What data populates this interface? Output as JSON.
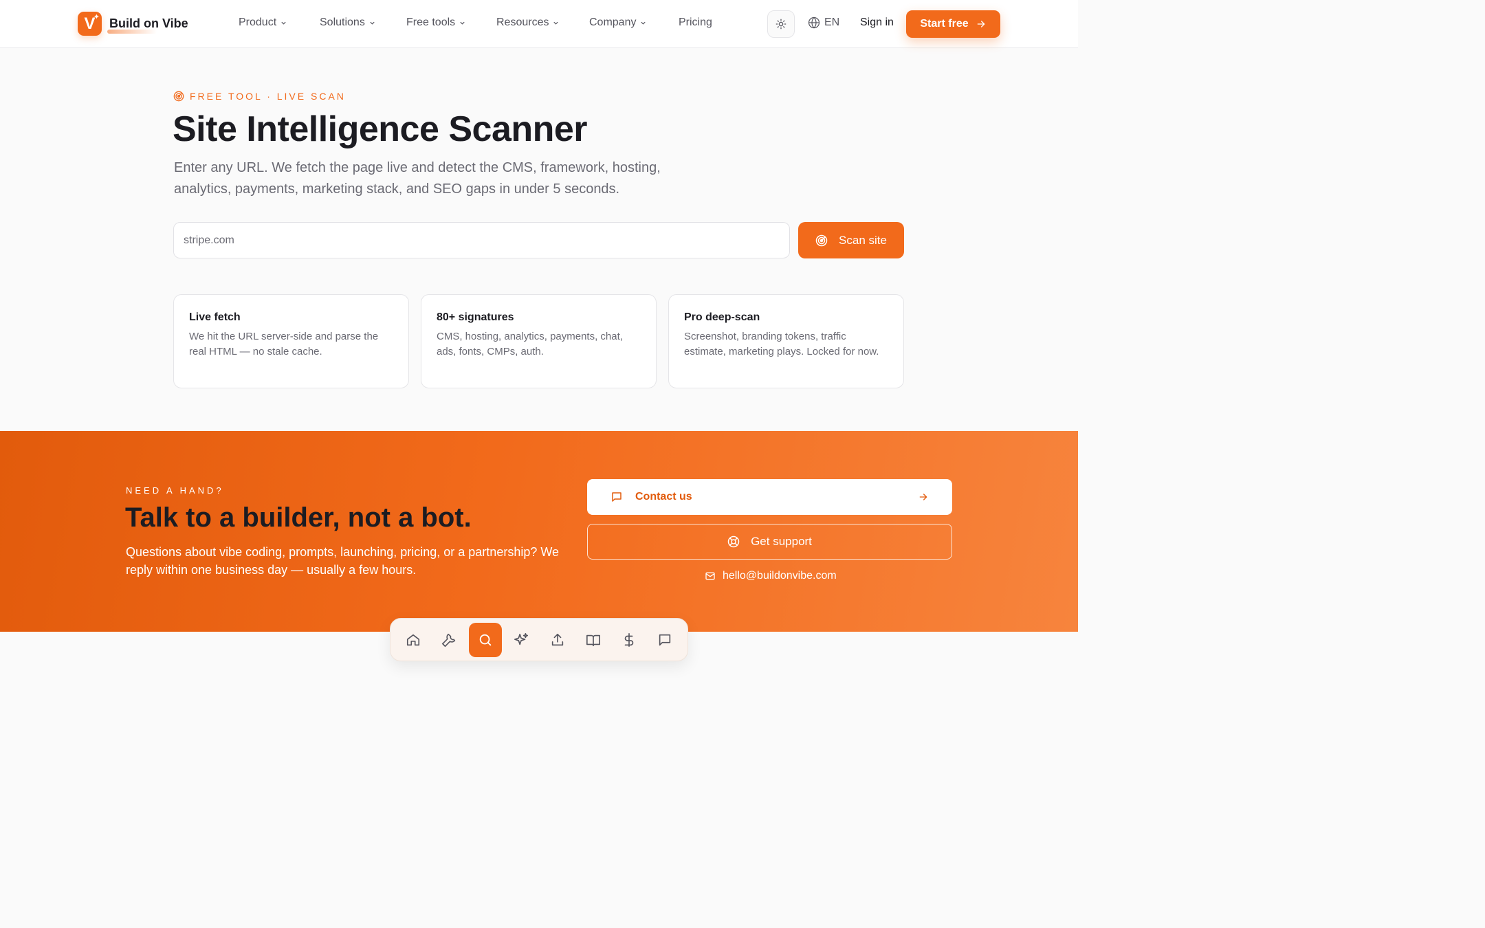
{
  "header": {
    "brand": "Build on Vibe",
    "logo_letter": "V",
    "nav": [
      {
        "label": "Product",
        "dropdown": true
      },
      {
        "label": "Solutions",
        "dropdown": true
      },
      {
        "label": "Free tools",
        "dropdown": true
      },
      {
        "label": "Resources",
        "dropdown": true
      },
      {
        "label": "Company",
        "dropdown": true
      },
      {
        "label": "Pricing",
        "dropdown": false
      }
    ],
    "theme_icon": "sun-icon",
    "language": "EN",
    "sign_in": "Sign in",
    "start_free": "Start free"
  },
  "hero": {
    "eyebrow": "FREE TOOL · LIVE SCAN",
    "title": "Site Intelligence Scanner",
    "subtitle": "Enter any URL. We fetch the page live and detect the CMS, framework, hosting, analytics, payments, marketing stack, and SEO gaps in under 5 seconds.",
    "input_placeholder": "stripe.com",
    "scan_button": "Scan site"
  },
  "features": [
    {
      "title": "Live fetch",
      "text": "We hit the URL server-side and parse the real HTML — no stale cache."
    },
    {
      "title": "80+ signatures",
      "text": "CMS, hosting, analytics, payments, chat, ads, fonts, CMPs, auth."
    },
    {
      "title": "Pro deep-scan",
      "text": "Screenshot, branding tokens, traffic estimate, marketing plays. Locked for now."
    }
  ],
  "cta": {
    "eyebrow": "NEED A HAND?",
    "title": "Talk to a builder, not a bot.",
    "text": "Questions about vibe coding, prompts, launching, pricing, or a partnership? We reply within one business day — usually a few hours.",
    "contact": "Contact us",
    "support": "Get support",
    "email": "hello@buildonvibe.com"
  },
  "dock": {
    "items": [
      "home-icon",
      "wrench-icon",
      "search-icon",
      "sparkles-icon",
      "upload-icon",
      "book-icon",
      "dollar-icon",
      "chat-icon"
    ],
    "active": "search-icon"
  },
  "colors": {
    "accent": "#f26a1b",
    "text": "#1c1c22",
    "muted": "#6b6b74"
  }
}
